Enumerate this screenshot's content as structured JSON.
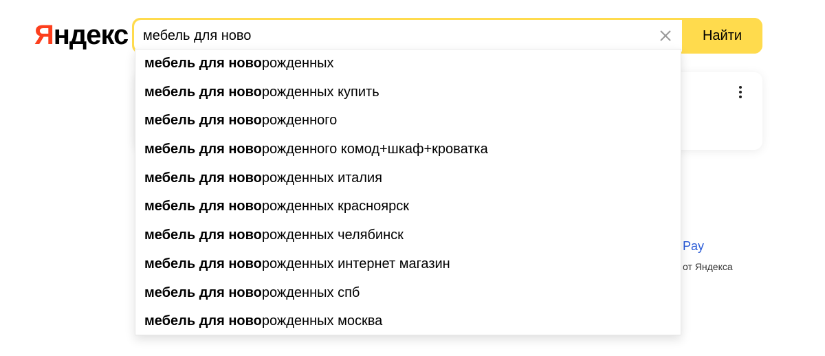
{
  "logo": {
    "first_letter": "Я",
    "rest": "ндекс",
    "brand_color": "#fc3f1d"
  },
  "search": {
    "value": "мебель для ново",
    "button_label": "Найти",
    "accent_color": "#ffdb4d"
  },
  "suggestions": [
    {
      "prefix": "мебель для ново",
      "suffix": "рожденных"
    },
    {
      "prefix": "мебель для ново",
      "suffix": "рожденных купить"
    },
    {
      "prefix": "мебель для ново",
      "suffix": "рожденного"
    },
    {
      "prefix": "мебель для ново",
      "suffix": "рожденного комод+шкаф+кроватка"
    },
    {
      "prefix": "мебель для ново",
      "suffix": "рожденных италия"
    },
    {
      "prefix": "мебель для ново",
      "suffix": "рожденных красноярск"
    },
    {
      "prefix": "мебель для ново",
      "suffix": "рожденных челябинск"
    },
    {
      "prefix": "мебель для ново",
      "suffix": "рожденных интернет магазин"
    },
    {
      "prefix": "мебель для ново",
      "suffix": "рожденных спб"
    },
    {
      "prefix": "мебель для ново",
      "suffix": "рожденных москва"
    }
  ],
  "background_widget": {
    "pay_label": "Pay",
    "pay_sub": "от Яндекса"
  }
}
